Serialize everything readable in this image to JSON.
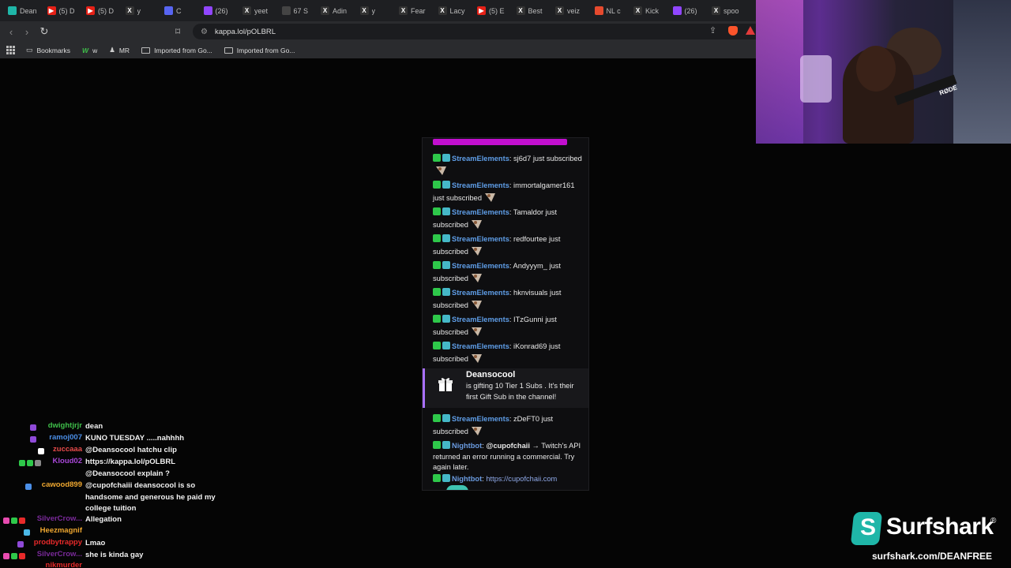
{
  "browser": {
    "tabs": [
      {
        "label": "Dean",
        "icon": "s-icon",
        "color": "#1fb6a8"
      },
      {
        "label": "(5) D",
        "icon": "youtube-icon",
        "color": "#e62117"
      },
      {
        "label": "(5) D",
        "icon": "youtube-icon",
        "color": "#e62117"
      },
      {
        "label": "y",
        "icon": "x-icon",
        "color": "#333333"
      },
      {
        "label": "C",
        "icon": "discord-icon",
        "color": "#5865f2"
      },
      {
        "label": "(26)",
        "icon": "twitch-icon",
        "color": "#9146ff"
      },
      {
        "label": "yeet",
        "icon": "x-icon",
        "color": "#333333"
      },
      {
        "label": "67 S",
        "icon": "number-icon",
        "color": "#444444"
      },
      {
        "label": "Adin",
        "icon": "x-icon",
        "color": "#333333"
      },
      {
        "label": "y",
        "icon": "x-icon",
        "color": "#333333"
      },
      {
        "label": "Fear",
        "icon": "x-icon",
        "color": "#333333"
      },
      {
        "label": "Lacy",
        "icon": "x-icon",
        "color": "#333333"
      },
      {
        "label": "(5) E",
        "icon": "youtube-icon",
        "color": "#e62117"
      },
      {
        "label": "Best",
        "icon": "x-icon",
        "color": "#333333"
      },
      {
        "label": "veiz",
        "icon": "x-icon",
        "color": "#333333"
      },
      {
        "label": "NL c",
        "icon": "kick-icon",
        "color": "#e64a2e"
      },
      {
        "label": "Kick",
        "icon": "x-icon",
        "color": "#333333"
      },
      {
        "label": "(26)",
        "icon": "twitch-icon",
        "color": "#9146ff"
      },
      {
        "label": "spoo",
        "icon": "x-icon",
        "color": "#333333"
      }
    ],
    "url": "kappa.lol/pOLBRL",
    "bookmarks": [
      "Bookmarks",
      "w",
      "MR",
      "Imported from Go...",
      "Imported from Go..."
    ]
  },
  "chat_popup": {
    "messages": [
      {
        "user": "StreamElements",
        "text": ": sj6d7 just subscribed"
      },
      {
        "user": "StreamElements",
        "text": ": immortalgamer161 just subscribed"
      },
      {
        "user": "StreamElements",
        "text": ": Tamaldor just subscribed"
      },
      {
        "user": "StreamElements",
        "text": ": redfourtee just subscribed"
      },
      {
        "user": "StreamElements",
        "text": ": Andyyym_ just subscribed"
      },
      {
        "user": "StreamElements",
        "text": ": hknvisuals just subscribed"
      },
      {
        "user": "StreamElements",
        "text": ": ITzGunni just subscribed"
      },
      {
        "user": "StreamElements",
        "text": ": iKonrad69 just subscribed"
      }
    ],
    "gift": {
      "name": "Deansocool",
      "text": "is gifting 10 Tier 1 Subs . It's their first Gift Sub in the channel!"
    },
    "after_gift": {
      "user": "StreamElements",
      "text": ": zDeFT0 just subscribed"
    },
    "nightbot1": {
      "user": "Nightbot",
      "mention": "@cupofchaii",
      "text": " → Twitch's API returned an error running a commercial. Try again later."
    },
    "nightbot2": {
      "user": "Nightbot",
      "link": "https://cupofchaii.com"
    }
  },
  "stream_chat": [
    {
      "user": "dwightjrjr",
      "color": "#3fbf4a",
      "text": "dean"
    },
    {
      "user": "ramoj007",
      "color": "#4b8fe8",
      "text": "KUNO TUESDAY .....nahhhh"
    },
    {
      "user": "zuccaaa",
      "color": "#e84b4b",
      "text": "@Deansocool hatchu clip"
    },
    {
      "user": "Kloud02",
      "color": "#a847d8",
      "text": "https://kappa.lol/pOLBRL"
    },
    {
      "user": "",
      "color": "#ffffff",
      "text": "@Deansocool explain ?"
    },
    {
      "user": "cawood899",
      "color": "#f0a830",
      "text": "@cupofchaiii deansocool is so handsome and generous he paid my college tuition"
    },
    {
      "user": "SilverCrow...",
      "color": "#7a2a9a",
      "text": "Allegation"
    },
    {
      "user": "Heezmagnif",
      "color": "#f0a830",
      "text": ""
    },
    {
      "user": "prodbytrappy",
      "color": "#e82a2a",
      "text": "Lmao"
    },
    {
      "user": "SilverCrow...",
      "color": "#7a2a9a",
      "text": "she is kinda gay"
    },
    {
      "user": "nikmurder",
      "color": "#e82a2a",
      "text": ""
    }
  ],
  "sponsor": {
    "name": "Surfshark",
    "url": "surfshark.com/DEANFREE"
  }
}
